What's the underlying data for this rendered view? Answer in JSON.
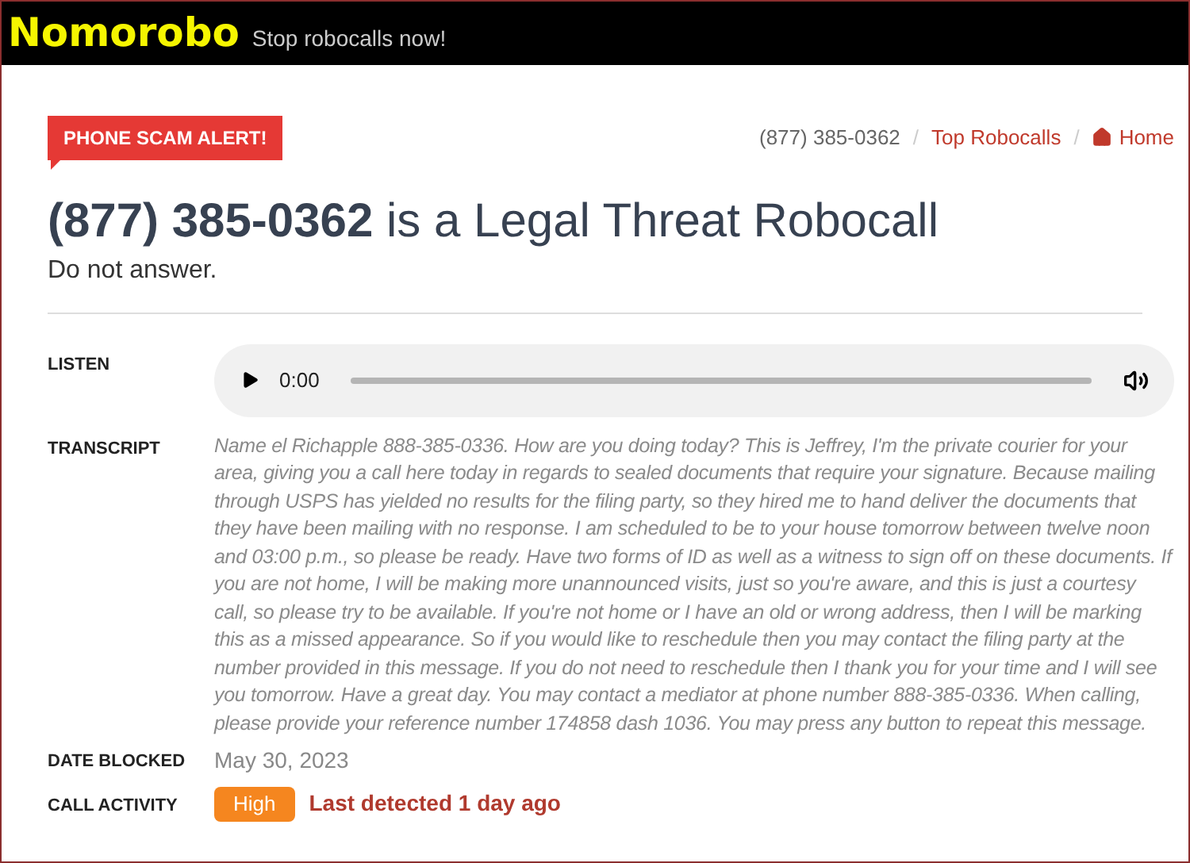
{
  "header": {
    "logo": "Nomorobo",
    "tagline": "Stop robocalls now!"
  },
  "alert_badge": "PHONE SCAM ALERT!",
  "breadcrumb_separator": "/",
  "breadcrumb": [
    {
      "label": "(877) 385-0362",
      "kind": "current"
    },
    {
      "label": "Top Robocalls",
      "kind": "link"
    },
    {
      "label": "Home",
      "kind": "home"
    }
  ],
  "heading": {
    "number": "(877) 385-0362",
    "rest": "is a Legal Threat Robocall"
  },
  "subheading": "Do not answer.",
  "listen": {
    "label": "LISTEN",
    "time": "0:00"
  },
  "transcript": {
    "label": "TRANSCRIPT",
    "text": "Name el Richapple 888-385-0336. How are you doing today? This is Jeffrey, I'm the private courier for your area, giving you a call here today in regards to sealed documents that require your signature. Because mailing through USPS has yielded no results for the filing party, so they hired me to hand deliver the documents that they have been mailing with no response. I am scheduled to be to your house tomorrow between twelve noon and 03:00 p.m., so please be ready. Have two forms of ID as well as a witness to sign off on these documents. If you are not home, I will be making more unannounced visits, just so you're aware, and this is just a courtesy call, so please try to be available. If you're not home or I have an old or wrong address, then I will be marking this as a missed appearance. So if you would like to reschedule then you may contact the filing party at the number provided in this message. If you do not need to reschedule then I thank you for your time and I will see you tomorrow. Have a great day. You may contact a mediator at phone number 888-385-0336. When calling, please provide your reference number 174858 dash 1036. You may press any button to repeat this message."
  },
  "date_blocked": {
    "label": "DATE BLOCKED",
    "value": "May 30, 2023"
  },
  "call_activity": {
    "label": "CALL ACTIVITY",
    "level_badge": "High",
    "color": "#f5861f",
    "last_detected": "Last detected 1 day ago"
  }
}
